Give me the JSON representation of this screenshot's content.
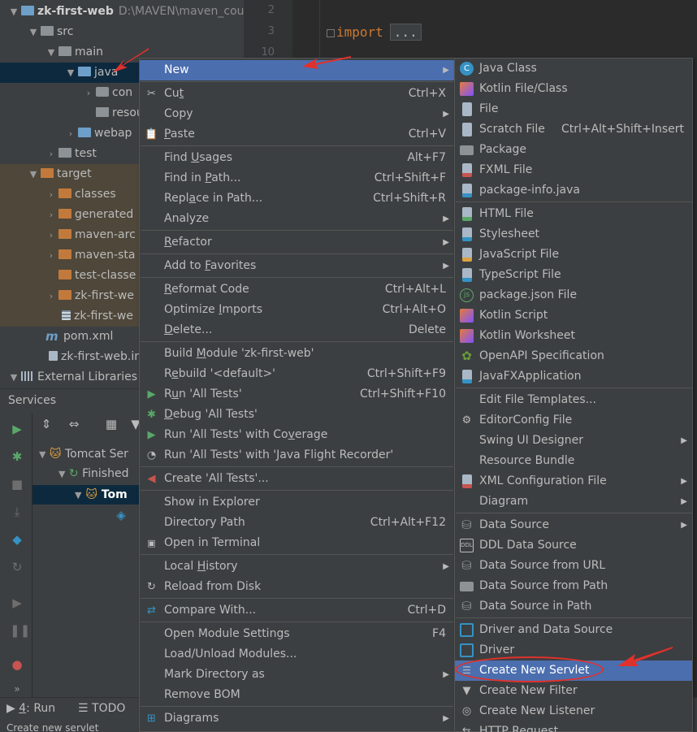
{
  "project_tree": {
    "items": [
      {
        "label": "zk-first-web",
        "path": "D:\\MAVEN\\maven_cour",
        "bold": true
      },
      {
        "label": "src"
      },
      {
        "label": "main"
      },
      {
        "label": "java"
      },
      {
        "label": "con"
      },
      {
        "label": "resour"
      },
      {
        "label": "webap"
      },
      {
        "label": "test"
      },
      {
        "label": "target"
      },
      {
        "label": "classes"
      },
      {
        "label": "generated"
      },
      {
        "label": "maven-arc"
      },
      {
        "label": "maven-sta"
      },
      {
        "label": "test-classe"
      },
      {
        "label": "zk-first-we"
      },
      {
        "label": "zk-first-we"
      },
      {
        "label": "pom.xml"
      },
      {
        "label": "zk-first-web.in"
      },
      {
        "label": "External Libraries"
      }
    ]
  },
  "editor": {
    "line_numbers": [
      "2",
      "3",
      "10"
    ],
    "keyword": "import",
    "folded": "..."
  },
  "services": {
    "title": "Services",
    "items": [
      "Tomcat Ser",
      "Finished",
      "Tom"
    ]
  },
  "bottom_bar": {
    "run_num": "4",
    "run_label": ": Run",
    "todo_label": "TODO"
  },
  "status_text": "Create new servlet",
  "context_menu": {
    "new": "New",
    "cut_pre": "Cu",
    "cut_u": "t",
    "cut_sc": "Ctrl+X",
    "copy": "Copy",
    "paste_u": "P",
    "paste_post": "aste",
    "paste_sc": "Ctrl+V",
    "find_usages_pre": "Find ",
    "find_usages_u": "U",
    "find_usages_post": "sages",
    "find_usages_sc": "Alt+F7",
    "find_in_path_pre": "Find in ",
    "find_in_path_u": "P",
    "find_in_path_post": "ath...",
    "find_in_path_sc": "Ctrl+Shift+F",
    "replace_pre": "Repl",
    "replace_u": "a",
    "replace_post": "ce in Path...",
    "replace_sc": "Ctrl+Shift+R",
    "analyze": "Analyze",
    "refactor_u": "R",
    "refactor_post": "efactor",
    "favorites_pre": "Add to ",
    "favorites_u": "F",
    "favorites_post": "avorites",
    "reformat_u": "R",
    "reformat_post": "eformat Code",
    "reformat_sc": "Ctrl+Alt+L",
    "optimize_pre": "Optimize ",
    "optimize_u": "I",
    "optimize_post": "mports",
    "optimize_sc": "Ctrl+Alt+O",
    "delete_u": "D",
    "delete_post": "elete...",
    "delete_sc": "Delete",
    "build_pre": "Build ",
    "build_u": "M",
    "build_post": "odule 'zk-first-web'",
    "rebuild_pre": "R",
    "rebuild_u": "e",
    "rebuild_post": "build '<default>'",
    "rebuild_sc": "Ctrl+Shift+F9",
    "run_pre": "R",
    "run_u": "u",
    "run_post": "n 'All Tests'",
    "run_sc": "Ctrl+Shift+F10",
    "debug_u": "D",
    "debug_post": "ebug 'All Tests'",
    "coverage_pre": "Run 'All Tests' with Co",
    "coverage_u": "v",
    "coverage_post": "erage",
    "jfr": "Run 'All Tests' with 'Java Flight Recorder'",
    "create_tests": "Create 'All Tests'...",
    "show_explorer": "Show in Explorer",
    "dir_path": "Directory Path",
    "dir_path_sc": "Ctrl+Alt+F12",
    "open_terminal": "Open in Terminal",
    "local_history_pre": "Local ",
    "local_history_u": "H",
    "local_history_post": "istory",
    "reload": "Reload from Disk",
    "compare_pre": "Compare With...",
    "compare_sc": "Ctrl+D",
    "module_settings": "Open Module Settings",
    "module_settings_sc": "F4",
    "load_unload": "Load/Unload Modules...",
    "mark_dir": "Mark Directory as",
    "remove_bom": "Remove BOM",
    "diagrams": "Diagrams"
  },
  "new_submenu": {
    "items": [
      "Java Class",
      "Kotlin File/Class",
      "File",
      "Scratch File",
      "Package",
      "FXML File",
      "package-info.java",
      "HTML File",
      "Stylesheet",
      "JavaScript File",
      "TypeScript File",
      "package.json File",
      "Kotlin Script",
      "Kotlin Worksheet",
      "OpenAPI Specification",
      "JavaFXApplication",
      "Edit File Templates...",
      "EditorConfig File",
      "Swing UI Designer",
      "Resource Bundle",
      "XML Configuration File",
      "Diagram",
      "Data Source",
      "DDL Data Source",
      "Data Source from URL",
      "Data Source from Path",
      "Data Source in Path",
      "Driver and Data Source",
      "Driver",
      "Create New Servlet",
      "Create New Filter",
      "Create New Listener",
      "HTTP Request"
    ],
    "scratch_shortcut": "Ctrl+Alt+Shift+Insert"
  },
  "colors": {
    "menu_bg": "#3c3f41",
    "highlight": "#4b6eaf",
    "annotation": "#e0312b"
  }
}
